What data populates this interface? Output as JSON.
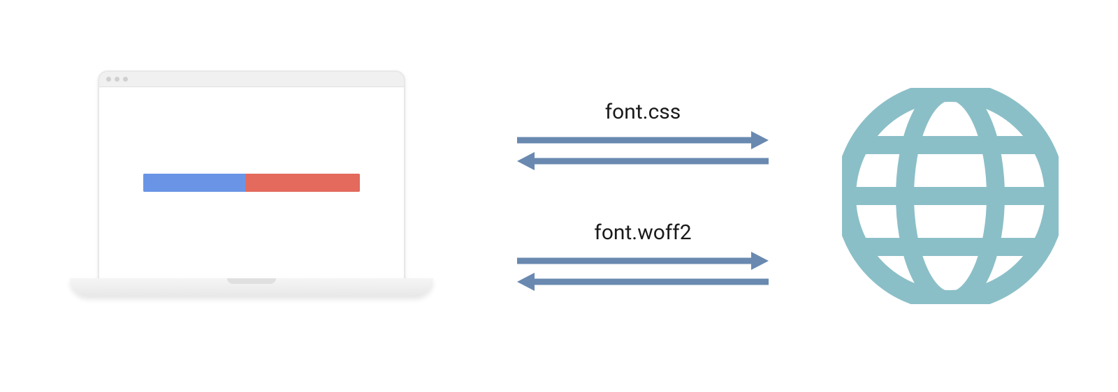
{
  "diagram": {
    "requests": [
      {
        "label": "font.css"
      },
      {
        "label": "font.woff2"
      }
    ],
    "colors": {
      "arrow": "#6989b0",
      "globe": "#8bbfc7",
      "progress_blue": "#6a95e6",
      "progress_red": "#e36a5c"
    }
  }
}
